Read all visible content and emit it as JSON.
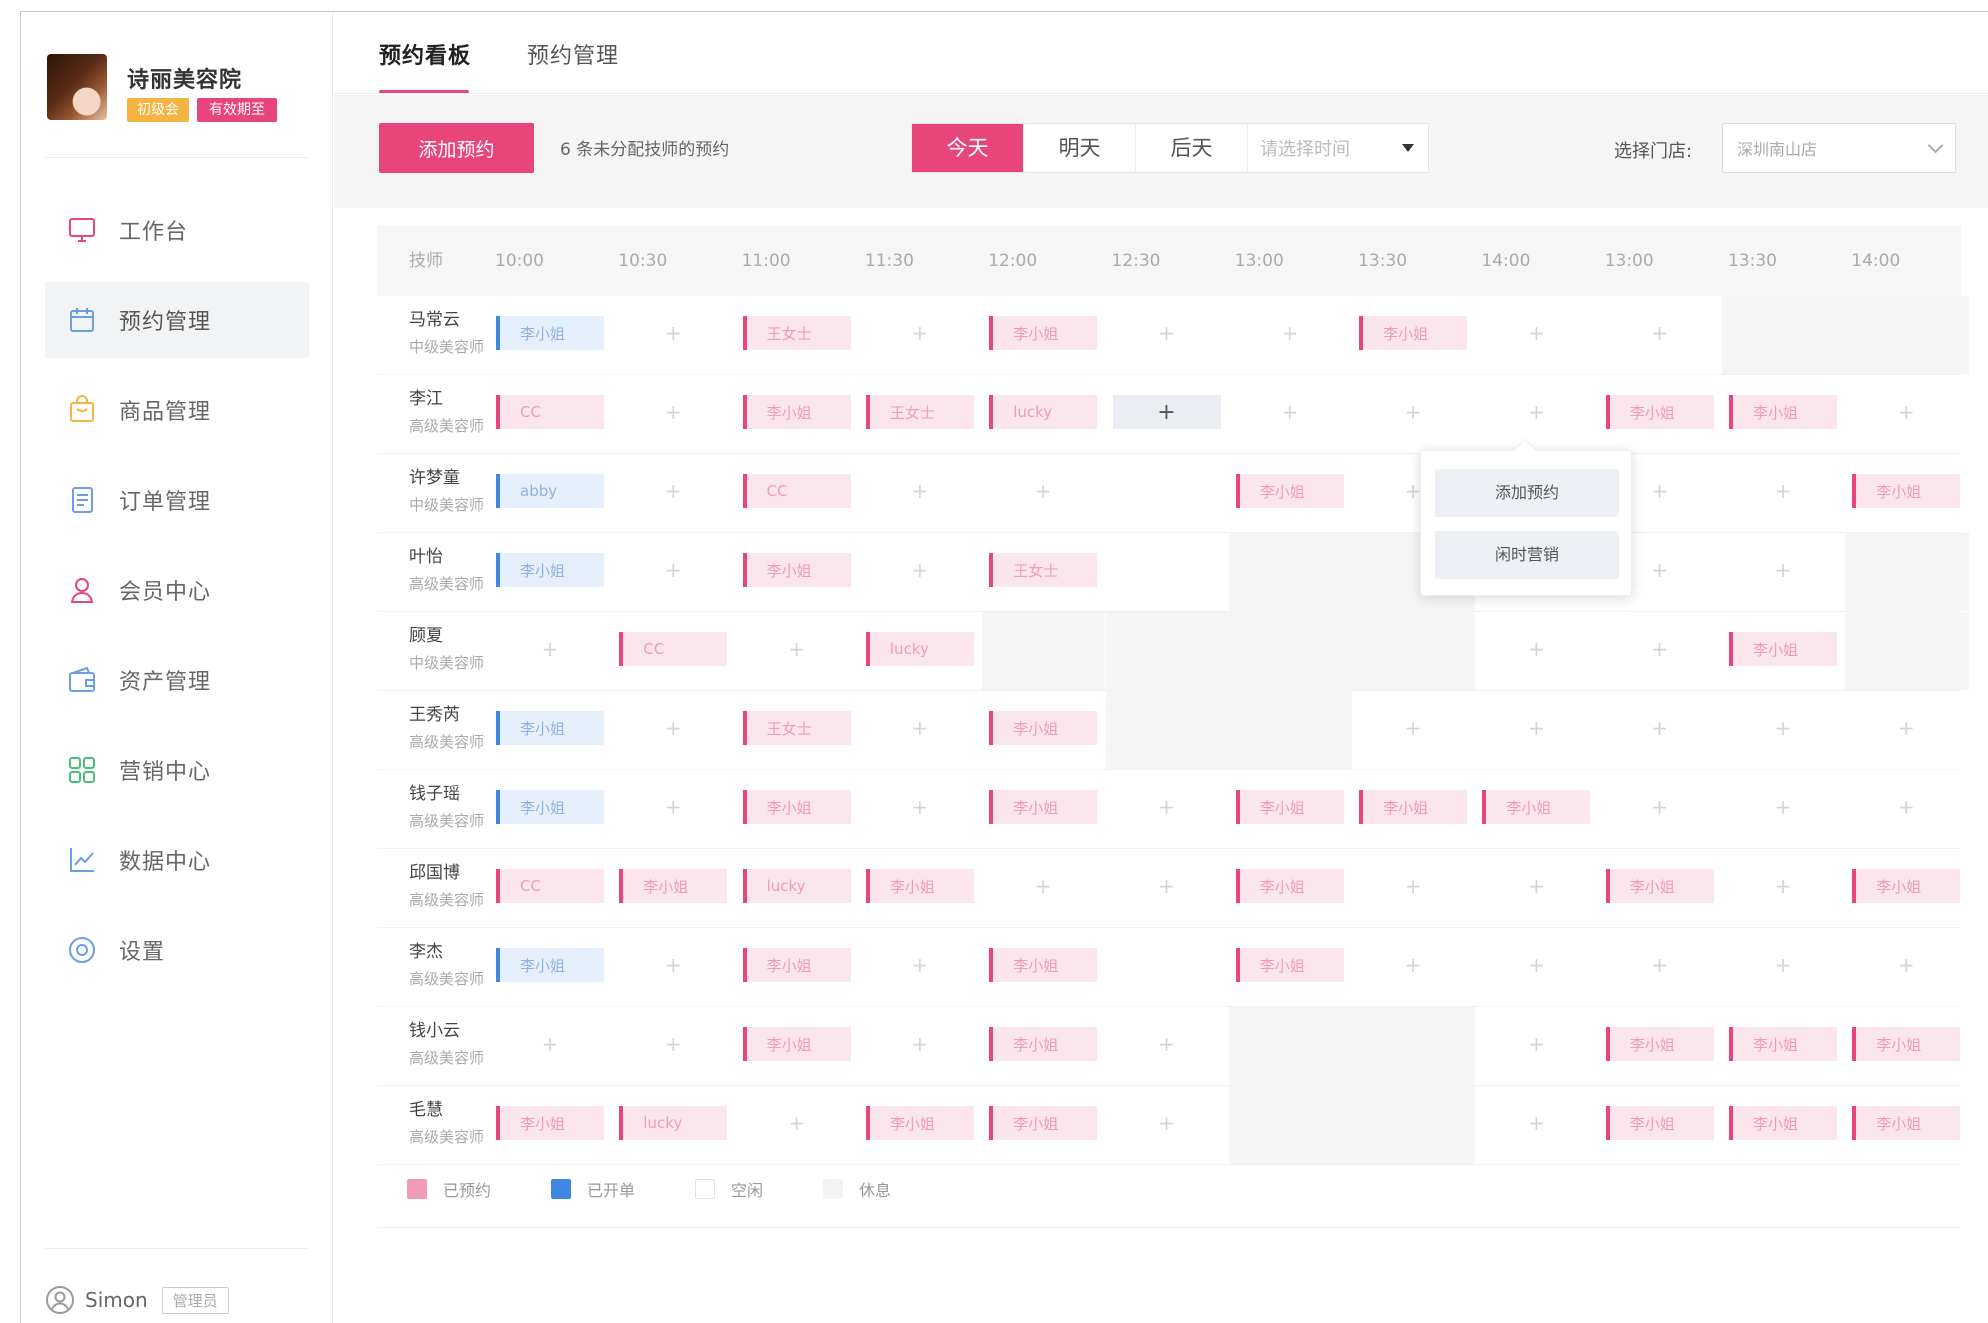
{
  "shop": {
    "name": "诗丽美容院",
    "level_badge": "初级会员",
    "trial_badge": "有效期至"
  },
  "sidebar": {
    "items": [
      {
        "label": "工作台",
        "icon": "monitor-icon",
        "color": "#e8457a"
      },
      {
        "label": "预约管理",
        "icon": "calendar-icon",
        "color": "#6a9fe6"
      },
      {
        "label": "商品管理",
        "icon": "bag-icon",
        "color": "#f5b342"
      },
      {
        "label": "订单管理",
        "icon": "list-doc-icon",
        "color": "#6a9fe6"
      },
      {
        "label": "会员中心",
        "icon": "user-icon",
        "color": "#e8457a"
      },
      {
        "label": "资产管理",
        "icon": "wallet-icon",
        "color": "#6a9fe6"
      },
      {
        "label": "营销中心",
        "icon": "apps-grid-icon",
        "color": "#4dbf7a"
      },
      {
        "label": "数据中心",
        "icon": "line-chart-icon",
        "color": "#6a9fe6"
      },
      {
        "label": "设置",
        "icon": "settings-icon",
        "color": "#6a9fe6"
      }
    ],
    "active_index": 1,
    "user": {
      "name": "Simon",
      "role": "管理员"
    }
  },
  "tabs": [
    {
      "label": "预约看板",
      "active": true
    },
    {
      "label": "预约管理",
      "active": false
    }
  ],
  "toolbar": {
    "add_button": "添加预约",
    "unassigned_text": "6 条未分配技师的预约",
    "days": [
      "今天",
      "明天",
      "后天"
    ],
    "active_day": 0,
    "date_placeholder": "请选择时间",
    "store_label": "选择门店:",
    "store_value": "深圳南山店"
  },
  "schedule": {
    "header_label": "技师",
    "times": [
      "10:00",
      "10:30",
      "11:00",
      "11:30",
      "12:00",
      "12:30",
      "13:00",
      "13:30",
      "14:00",
      "13:00",
      "13:30",
      "14:00"
    ],
    "rows": [
      {
        "name": "马常云",
        "role": "中级美容师",
        "cells": [
          {
            "t": "billed",
            "v": "李小姐"
          },
          {
            "t": "empty"
          },
          {
            "t": "booked",
            "v": "王女士"
          },
          {
            "t": "empty"
          },
          {
            "t": "booked",
            "v": "李小姐"
          },
          {
            "t": "empty"
          },
          {
            "t": "empty"
          },
          {
            "t": "booked",
            "v": "李小姐"
          },
          {
            "t": "empty"
          },
          {
            "t": "empty"
          },
          {
            "t": "off"
          },
          {
            "t": "off"
          }
        ]
      },
      {
        "name": "李江",
        "role": "高级美容师",
        "cells": [
          {
            "t": "booked",
            "v": "CC"
          },
          {
            "t": "empty"
          },
          {
            "t": "booked",
            "v": "李小姐"
          },
          {
            "t": "booked",
            "v": "王女士"
          },
          {
            "t": "booked",
            "v": "lucky"
          },
          {
            "t": "hover"
          },
          {
            "t": "empty"
          },
          {
            "t": "empty"
          },
          {
            "t": "empty"
          },
          {
            "t": "booked",
            "v": "李小姐"
          },
          {
            "t": "booked",
            "v": "李小姐"
          },
          {
            "t": "empty"
          }
        ]
      },
      {
        "name": "许梦童",
        "role": "中级美容师",
        "cells": [
          {
            "t": "billed",
            "v": "abby"
          },
          {
            "t": "empty"
          },
          {
            "t": "booked",
            "v": "CC"
          },
          {
            "t": "empty"
          },
          {
            "t": "empty"
          },
          {
            "t": "none"
          },
          {
            "t": "booked",
            "v": "李小姐"
          },
          {
            "t": "empty"
          },
          {
            "t": "empty"
          },
          {
            "t": "empty"
          },
          {
            "t": "empty"
          },
          {
            "t": "booked",
            "v": "李小姐"
          }
        ]
      },
      {
        "name": "叶怡",
        "role": "高级美容师",
        "cells": [
          {
            "t": "billed",
            "v": "李小姐"
          },
          {
            "t": "empty"
          },
          {
            "t": "booked",
            "v": "李小姐"
          },
          {
            "t": "empty"
          },
          {
            "t": "booked",
            "v": "王女士"
          },
          {
            "t": "none"
          },
          {
            "t": "off"
          },
          {
            "t": "off"
          },
          {
            "t": "empty"
          },
          {
            "t": "empty"
          },
          {
            "t": "empty"
          },
          {
            "t": "off"
          }
        ]
      },
      {
        "name": "顾夏",
        "role": "中级美容师",
        "cells": [
          {
            "t": "empty"
          },
          {
            "t": "booked",
            "v": "CC"
          },
          {
            "t": "empty"
          },
          {
            "t": "booked",
            "v": "lucky"
          },
          {
            "t": "off"
          },
          {
            "t": "off"
          },
          {
            "t": "off"
          },
          {
            "t": "off"
          },
          {
            "t": "empty"
          },
          {
            "t": "empty"
          },
          {
            "t": "booked",
            "v": "李小姐"
          },
          {
            "t": "off"
          }
        ]
      },
      {
        "name": "王秀芮",
        "role": "高级美容师",
        "cells": [
          {
            "t": "billed",
            "v": "李小姐"
          },
          {
            "t": "empty"
          },
          {
            "t": "booked",
            "v": "王女士"
          },
          {
            "t": "empty"
          },
          {
            "t": "booked",
            "v": "李小姐"
          },
          {
            "t": "off"
          },
          {
            "t": "off"
          },
          {
            "t": "empty"
          },
          {
            "t": "empty"
          },
          {
            "t": "empty"
          },
          {
            "t": "empty"
          },
          {
            "t": "empty"
          }
        ]
      },
      {
        "name": "钱子瑶",
        "role": "高级美容师",
        "cells": [
          {
            "t": "billed",
            "v": "李小姐"
          },
          {
            "t": "empty"
          },
          {
            "t": "booked",
            "v": "李小姐"
          },
          {
            "t": "empty"
          },
          {
            "t": "booked",
            "v": "李小姐"
          },
          {
            "t": "empty"
          },
          {
            "t": "booked",
            "v": "李小姐"
          },
          {
            "t": "booked",
            "v": "李小姐"
          },
          {
            "t": "booked",
            "v": "李小姐"
          },
          {
            "t": "empty"
          },
          {
            "t": "empty"
          },
          {
            "t": "empty"
          }
        ]
      },
      {
        "name": "邱国博",
        "role": "高级美容师",
        "cells": [
          {
            "t": "booked",
            "v": "CC"
          },
          {
            "t": "booked",
            "v": "李小姐"
          },
          {
            "t": "booked",
            "v": "lucky"
          },
          {
            "t": "booked",
            "v": "李小姐"
          },
          {
            "t": "empty"
          },
          {
            "t": "empty"
          },
          {
            "t": "booked",
            "v": "李小姐"
          },
          {
            "t": "empty"
          },
          {
            "t": "empty"
          },
          {
            "t": "booked",
            "v": "李小姐"
          },
          {
            "t": "empty"
          },
          {
            "t": "booked",
            "v": "李小姐"
          }
        ]
      },
      {
        "name": "李杰",
        "role": "高级美容师",
        "cells": [
          {
            "t": "billed",
            "v": "李小姐"
          },
          {
            "t": "empty"
          },
          {
            "t": "booked",
            "v": "李小姐"
          },
          {
            "t": "empty"
          },
          {
            "t": "booked",
            "v": "李小姐"
          },
          {
            "t": "none"
          },
          {
            "t": "booked",
            "v": "李小姐"
          },
          {
            "t": "empty"
          },
          {
            "t": "empty"
          },
          {
            "t": "empty"
          },
          {
            "t": "empty"
          },
          {
            "t": "empty"
          }
        ]
      },
      {
        "name": "钱小云",
        "role": "高级美容师",
        "cells": [
          {
            "t": "empty"
          },
          {
            "t": "empty"
          },
          {
            "t": "booked",
            "v": "李小姐"
          },
          {
            "t": "empty"
          },
          {
            "t": "booked",
            "v": "李小姐"
          },
          {
            "t": "empty"
          },
          {
            "t": "off"
          },
          {
            "t": "off"
          },
          {
            "t": "empty"
          },
          {
            "t": "booked",
            "v": "李小姐"
          },
          {
            "t": "booked",
            "v": "李小姐"
          },
          {
            "t": "booked",
            "v": "李小姐"
          }
        ]
      },
      {
        "name": "毛慧",
        "role": "高级美容师",
        "cells": [
          {
            "t": "booked",
            "v": "李小姐"
          },
          {
            "t": "booked",
            "v": "lucky"
          },
          {
            "t": "empty"
          },
          {
            "t": "booked",
            "v": "李小姐"
          },
          {
            "t": "booked",
            "v": "李小姐"
          },
          {
            "t": "empty"
          },
          {
            "t": "off"
          },
          {
            "t": "off"
          },
          {
            "t": "empty"
          },
          {
            "t": "booked",
            "v": "李小姐"
          },
          {
            "t": "booked",
            "v": "李小姐"
          },
          {
            "t": "booked",
            "v": "李小姐"
          }
        ]
      }
    ],
    "legend": [
      {
        "label": "已预约",
        "color": "#f09cb6"
      },
      {
        "label": "已开单",
        "color": "#3f87e0"
      },
      {
        "label": "空闲",
        "color": "#ffffff"
      },
      {
        "label": "休息",
        "color": "#f3f3f3"
      }
    ]
  },
  "popup": {
    "add": "添加预约",
    "idle_marketing": "闲时营销"
  },
  "colors": {
    "accent": "#e8457a",
    "billed": "#3f87e0"
  }
}
